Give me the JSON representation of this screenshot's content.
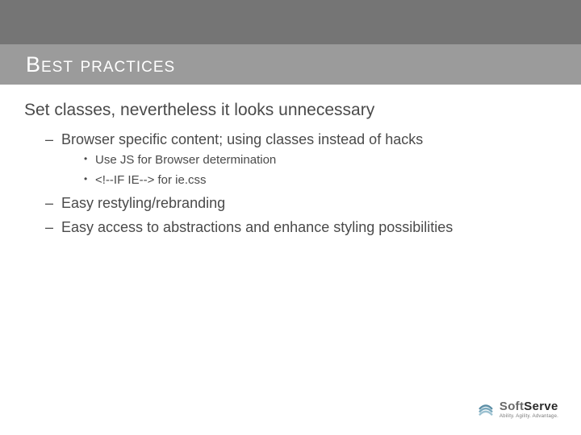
{
  "title": "Best practices",
  "heading": "Set classes, nevertheless it looks unnecessary",
  "bullets": {
    "b0": "Browser specific content; using classes instead of hacks",
    "b0_sub0": "Use JS for Browser determination",
    "b0_sub1": "<!--IF IE--> for ie.css",
    "b1": "Easy restyling/rebranding",
    "b2": "Easy access to abstractions and enhance styling possibilities"
  },
  "logo": {
    "name_soft": "Soft",
    "name_serve": "Serve",
    "tagline": "Ability. Agility. Advantage."
  }
}
